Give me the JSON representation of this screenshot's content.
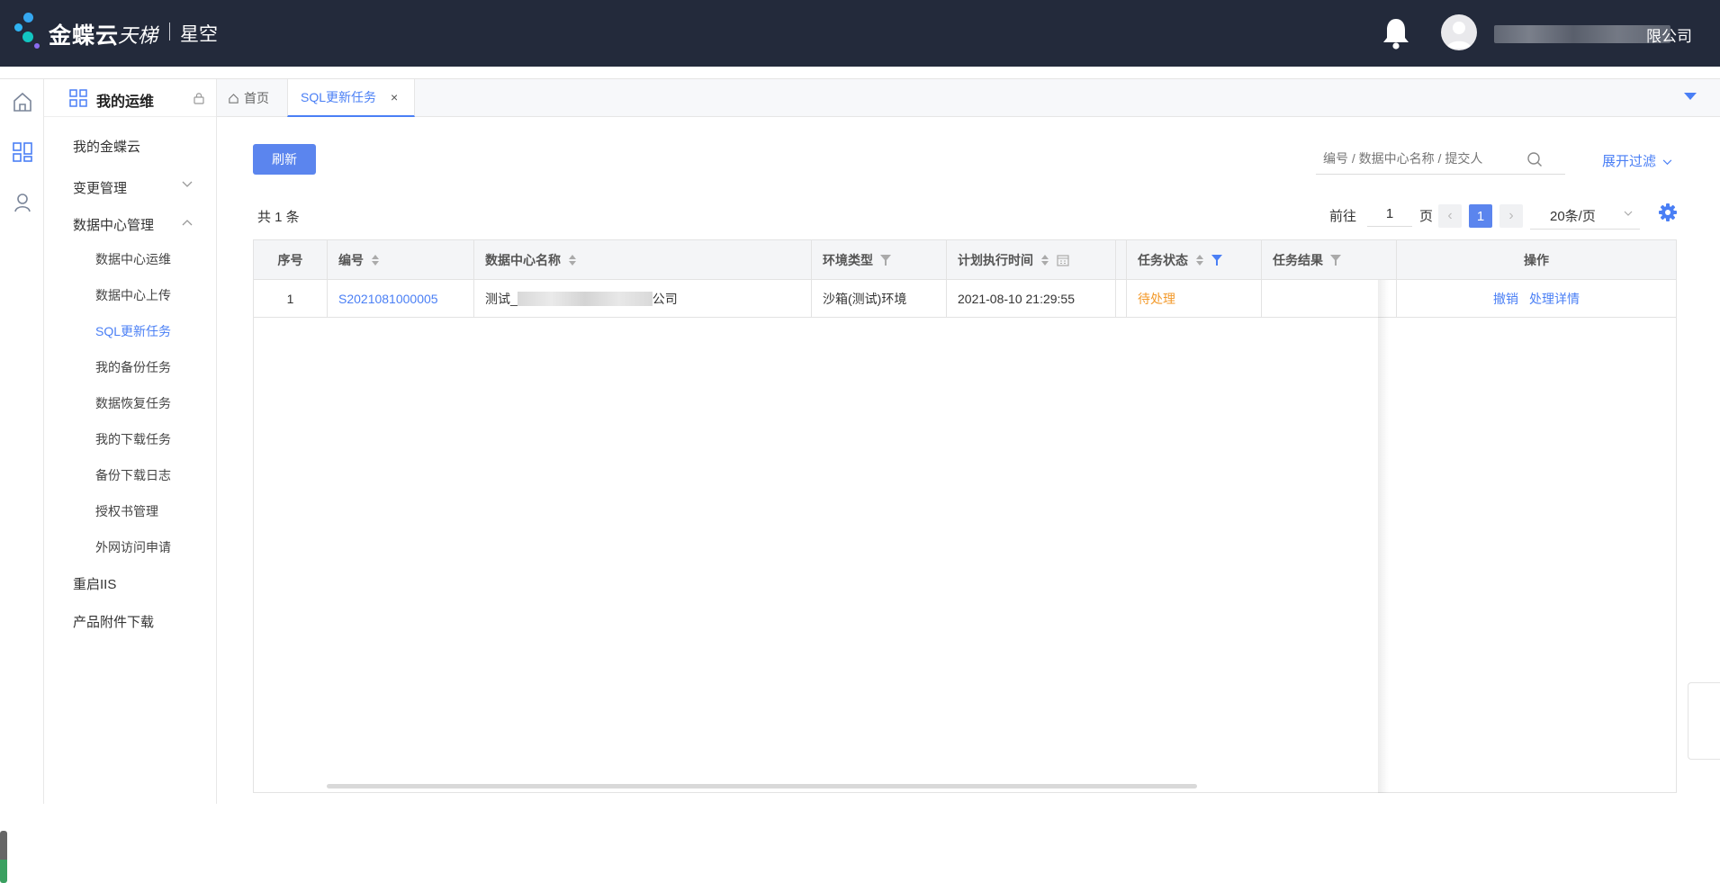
{
  "header": {
    "brand": "金蝶云",
    "brand_sub": "天梯",
    "product": "星空",
    "company_suffix": "限公司"
  },
  "sidebar": {
    "title": "我的运维",
    "items": [
      {
        "label": "我的金蝶云"
      },
      {
        "label": "变更管理"
      },
      {
        "label": "数据中心管理"
      },
      {
        "label": "数据中心运维"
      },
      {
        "label": "数据中心上传"
      },
      {
        "label": "SQL更新任务",
        "active": true
      },
      {
        "label": "我的备份任务"
      },
      {
        "label": "数据恢复任务"
      },
      {
        "label": "我的下载任务"
      },
      {
        "label": "备份下载日志"
      },
      {
        "label": "授权书管理"
      },
      {
        "label": "外网访问申请"
      },
      {
        "label": "重启IIS"
      },
      {
        "label": "产品附件下载"
      }
    ]
  },
  "tabs": [
    {
      "label": "首页"
    },
    {
      "label": "SQL更新任务",
      "close": "×"
    }
  ],
  "toolbar": {
    "refresh": "刷新",
    "search_placeholder": "编号 / 数据中心名称 / 提交人",
    "expand_filter": "展开过滤"
  },
  "pagination": {
    "total": "共 1 条",
    "goto": "前往",
    "page_input": "1",
    "page_unit": "页",
    "prev": "‹",
    "current": "1",
    "next": "›",
    "page_size": "20条/页"
  },
  "table": {
    "columns": [
      "序号",
      "编号",
      "数据中心名称",
      "环境类型",
      "计划执行时间",
      "任务状态",
      "任务结果",
      "操作"
    ],
    "rows": [
      {
        "index": "1",
        "code": "S2021081000005",
        "dc_name_prefix": "测试_",
        "dc_name_suffix": "公司",
        "env": "沙箱(测试)环境",
        "plan_time": "2021-08-10 21:29:55",
        "status": "待处理",
        "result": "",
        "actions": [
          "撤销",
          "处理详情"
        ]
      }
    ]
  },
  "colors": {
    "header_bg": "#232a3b",
    "accent": "#4a7ff5",
    "pending": "#f39a2b"
  },
  "icons": [
    "home-icon",
    "dashboard-icon",
    "user-icon",
    "grid-icon",
    "lock-icon",
    "bell-icon",
    "avatar-icon",
    "search-icon",
    "gear-icon",
    "sort-icon",
    "filter-icon",
    "calendar-icon",
    "chevron-down-icon",
    "chevron-up-icon",
    "close-icon",
    "caret-down-icon"
  ]
}
